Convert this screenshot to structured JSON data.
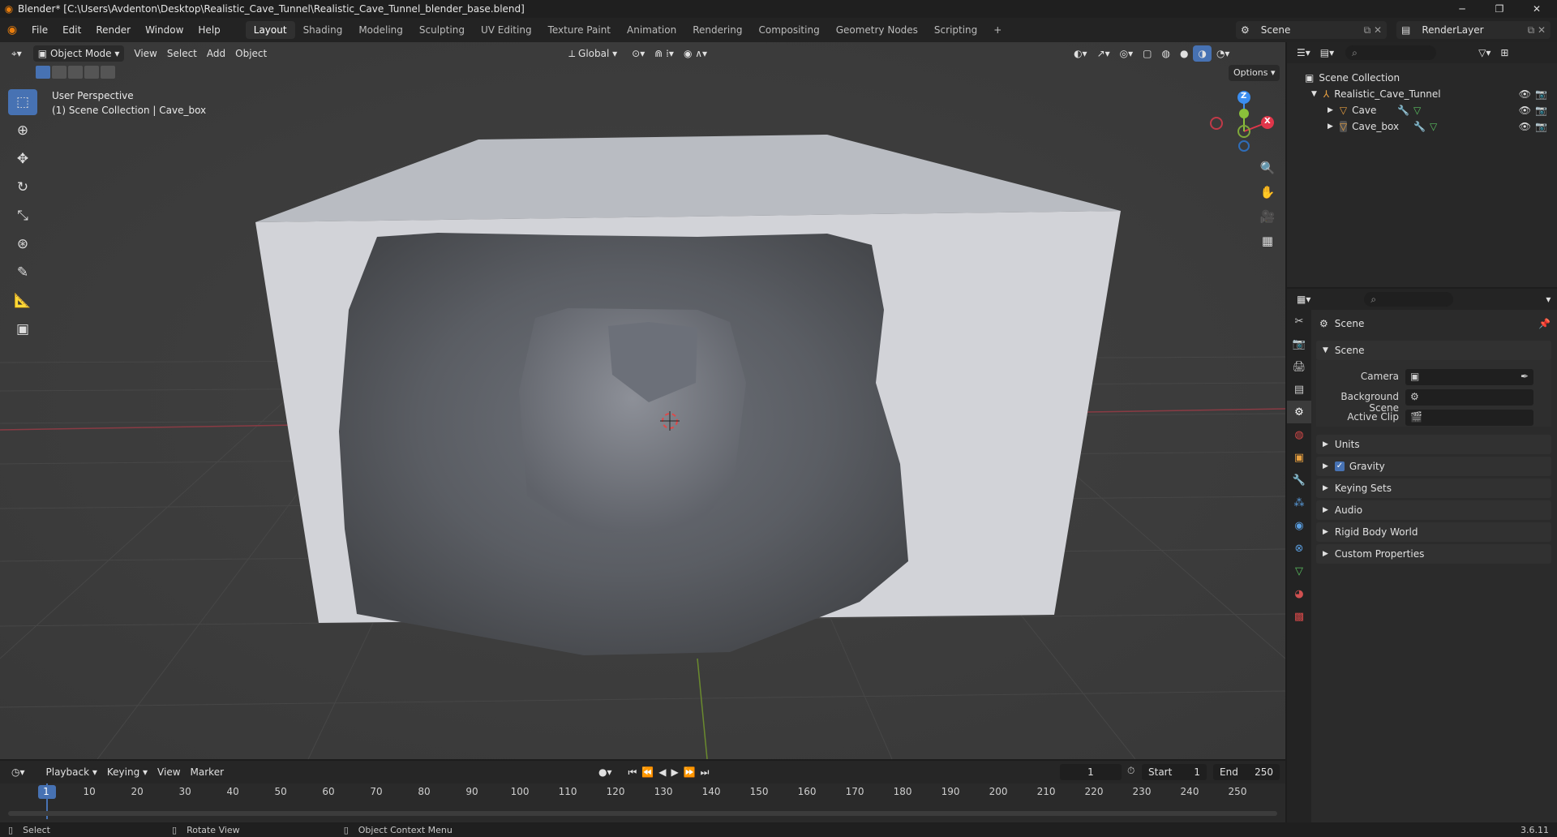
{
  "window": {
    "title": "Blender* [C:\\Users\\Avdenton\\Desktop\\Realistic_Cave_Tunnel\\Realistic_Cave_Tunnel_blender_base.blend]",
    "minimize": "─",
    "maximize": "❐",
    "close": "✕"
  },
  "menu": {
    "items": [
      "File",
      "Edit",
      "Render",
      "Window",
      "Help"
    ],
    "workspaces": [
      "Layout",
      "Shading",
      "Modeling",
      "Sculpting",
      "UV Editing",
      "Texture Paint",
      "Animation",
      "Rendering",
      "Compositing",
      "Geometry Nodes",
      "Scripting"
    ],
    "add_workspace": "+",
    "scene": "Scene",
    "view_layer": "RenderLayer"
  },
  "viewport": {
    "mode": "Object Mode",
    "menus": [
      "View",
      "Select",
      "Add",
      "Object"
    ],
    "orientation": "Global",
    "options": "Options",
    "perspective_label": "User Perspective",
    "collection_label": "(1) Scene Collection | Cave_box",
    "gizmo": {
      "z": "Z",
      "y": "Y",
      "x": "X"
    }
  },
  "outliner": {
    "root": "Scene Collection",
    "collection": "Realistic_Cave_Tunnel",
    "objects": [
      "Cave",
      "Cave_box"
    ]
  },
  "properties": {
    "context": "Scene",
    "panel_title": "Scene",
    "camera_label": "Camera",
    "background_scene_label": "Background Scene",
    "active_clip_label": "Active Clip",
    "collapsed_panels": [
      "Units",
      "Gravity",
      "Keying Sets",
      "Audio",
      "Rigid Body World",
      "Custom Properties"
    ],
    "gravity_checked": true
  },
  "timeline": {
    "menus": [
      "Playback",
      "Keying",
      "View",
      "Marker"
    ],
    "current_frame": "1",
    "start_label": "Start",
    "start_value": "1",
    "end_label": "End",
    "end_value": "250",
    "ticks": [
      "1",
      "10",
      "20",
      "30",
      "40",
      "50",
      "60",
      "70",
      "80",
      "90",
      "100",
      "110",
      "120",
      "130",
      "140",
      "150",
      "160",
      "170",
      "180",
      "190",
      "200",
      "210",
      "220",
      "230",
      "240",
      "250"
    ]
  },
  "status": {
    "select": "Select",
    "rotate": "Rotate View",
    "context_menu": "Object Context Menu",
    "version": "3.6.11"
  },
  "colors": {
    "accent": "#4772b3",
    "x_axis": "#e0364a",
    "y_axis": "#8ac13a",
    "z_axis": "#3b8ef0",
    "brand": "#e87d0d"
  }
}
